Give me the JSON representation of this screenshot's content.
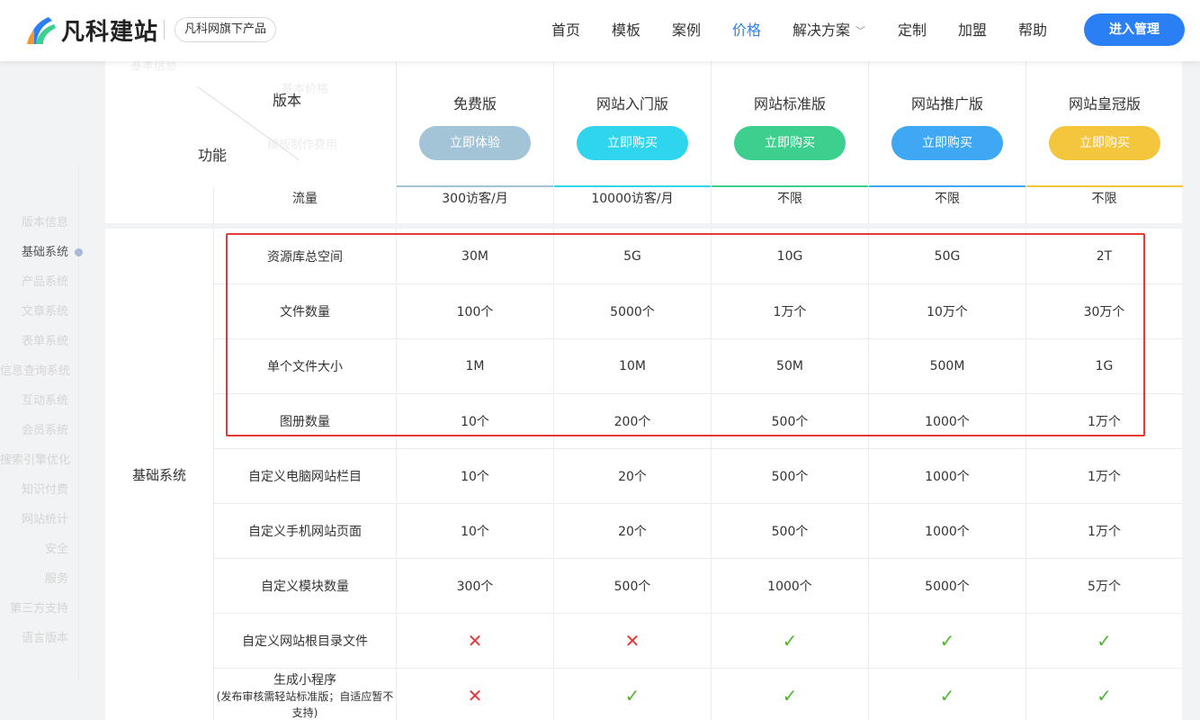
{
  "header": {
    "logo_text": "凡科建站",
    "badge": "凡科网旗下产品",
    "nav": [
      {
        "label": "首页",
        "active": false
      },
      {
        "label": "模板",
        "active": false
      },
      {
        "label": "案例",
        "active": false
      },
      {
        "label": "价格",
        "active": true
      },
      {
        "label": "解决方案",
        "active": false,
        "dropdown": true
      },
      {
        "label": "定制",
        "active": false
      },
      {
        "label": "加盟",
        "active": false
      },
      {
        "label": "帮助",
        "active": false
      }
    ],
    "manage_button": "进入管理",
    "accent_color": "#2b7ff5"
  },
  "sidebar": {
    "items": [
      "版本信息",
      "基础系统",
      "产品系统",
      "文章系统",
      "表单系统",
      "信息查询系统",
      "互动系统",
      "会员系统",
      "搜索引擎优化",
      "知识付费",
      "网站统计",
      "安全",
      "服务",
      "第三方支持",
      "语言版本"
    ],
    "active_index": 1
  },
  "table_header": {
    "version_label": "版本",
    "feature_label": "功能",
    "ghost_texts": [
      "基本信息",
      "基本价格",
      "模板制作费用"
    ],
    "plans": [
      {
        "name": "免费版",
        "button": "立即体验",
        "color": "#a3c4d6",
        "bar_color": "#a3c4d6"
      },
      {
        "name": "网站入门版",
        "button": "立即购买",
        "color": "#2ed5ec",
        "bar_color": "#2ed5ec"
      },
      {
        "name": "网站标准版",
        "button": "立即购买",
        "color": "#3ccf8e",
        "bar_color": "#3ccf8e"
      },
      {
        "name": "网站推广版",
        "button": "立即购买",
        "color": "#3fa8f5",
        "bar_color": "#3fa8f5"
      },
      {
        "name": "网站皇冠版",
        "button": "立即购买",
        "color": "#f4c63d",
        "bar_color": "#f4c63d"
      }
    ]
  },
  "traffic_row": {
    "label": "流量",
    "values": [
      "300访客/月",
      "10000访客/月",
      "不限",
      "不限",
      "不限"
    ]
  },
  "section": {
    "name": "基础系统",
    "rows": [
      {
        "label": "资源库总空间",
        "values": [
          "30M",
          "5G",
          "10G",
          "50G",
          "2T"
        ]
      },
      {
        "label": "文件数量",
        "values": [
          "100个",
          "5000个",
          "1万个",
          "10万个",
          "30万个"
        ]
      },
      {
        "label": "单个文件大小",
        "values": [
          "1M",
          "10M",
          "50M",
          "500M",
          "1G"
        ]
      },
      {
        "label": "图册数量",
        "values": [
          "10个",
          "200个",
          "500个",
          "1000个",
          "1万个"
        ]
      },
      {
        "label": "自定义电脑网站栏目",
        "values": [
          "10个",
          "20个",
          "500个",
          "1000个",
          "1万个"
        ]
      },
      {
        "label": "自定义手机网站页面",
        "values": [
          "10个",
          "20个",
          "500个",
          "1000个",
          "1万个"
        ]
      },
      {
        "label": "自定义模块数量",
        "values": [
          "300个",
          "500个",
          "1000个",
          "5000个",
          "5万个"
        ]
      },
      {
        "label": "自定义网站根目录文件",
        "values": [
          "no",
          "no",
          "yes",
          "yes",
          "yes"
        ]
      },
      {
        "label": "生成小程序",
        "note": "(发布审核需轻站标准版；自适应暂不支持)",
        "values": [
          "no",
          "yes",
          "yes",
          "yes",
          "yes"
        ]
      }
    ]
  },
  "marks": {
    "yes": "✓",
    "no": "✕"
  }
}
